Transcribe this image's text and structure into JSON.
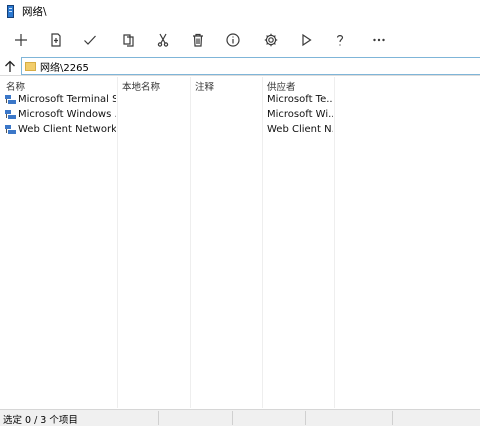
{
  "window": {
    "title": "网络\\"
  },
  "toolbar": {
    "buttons": [
      {
        "name": "new",
        "icon": "plus-icon"
      },
      {
        "name": "new-document",
        "icon": "new-document-icon"
      },
      {
        "name": "check",
        "icon": "checkmark-icon"
      },
      {
        "name": "copy",
        "icon": "copy-icon"
      },
      {
        "name": "cut",
        "icon": "scissors-icon"
      },
      {
        "name": "delete",
        "icon": "trash-icon"
      },
      {
        "name": "properties",
        "icon": "info-icon"
      },
      {
        "name": "settings",
        "icon": "gear-icon"
      },
      {
        "name": "run",
        "icon": "play-icon"
      },
      {
        "name": "help",
        "icon": "question-icon"
      },
      {
        "name": "more",
        "icon": "ellipsis-icon"
      }
    ]
  },
  "address": {
    "path": "网络\\2265",
    "folder_color": "#f2cd6b"
  },
  "list": {
    "columns": [
      "名称",
      "本地名称",
      "注释",
      "供应者"
    ],
    "rows": [
      {
        "name": "Microsoft Terminal S...",
        "local": "",
        "comment": "",
        "provider": "Microsoft Te..."
      },
      {
        "name": "Microsoft Windows ...",
        "local": "",
        "comment": "",
        "provider": "Microsoft Wi..."
      },
      {
        "name": "Web Client Network",
        "local": "",
        "comment": "",
        "provider": "Web Client N..."
      }
    ]
  },
  "status": {
    "text": "选定 0 / 3 个项目"
  },
  "colors": {
    "accent_border": "#7fb5d8",
    "network_icon": "#3b77c8",
    "statusbar_bg": "#f0f0f0"
  }
}
